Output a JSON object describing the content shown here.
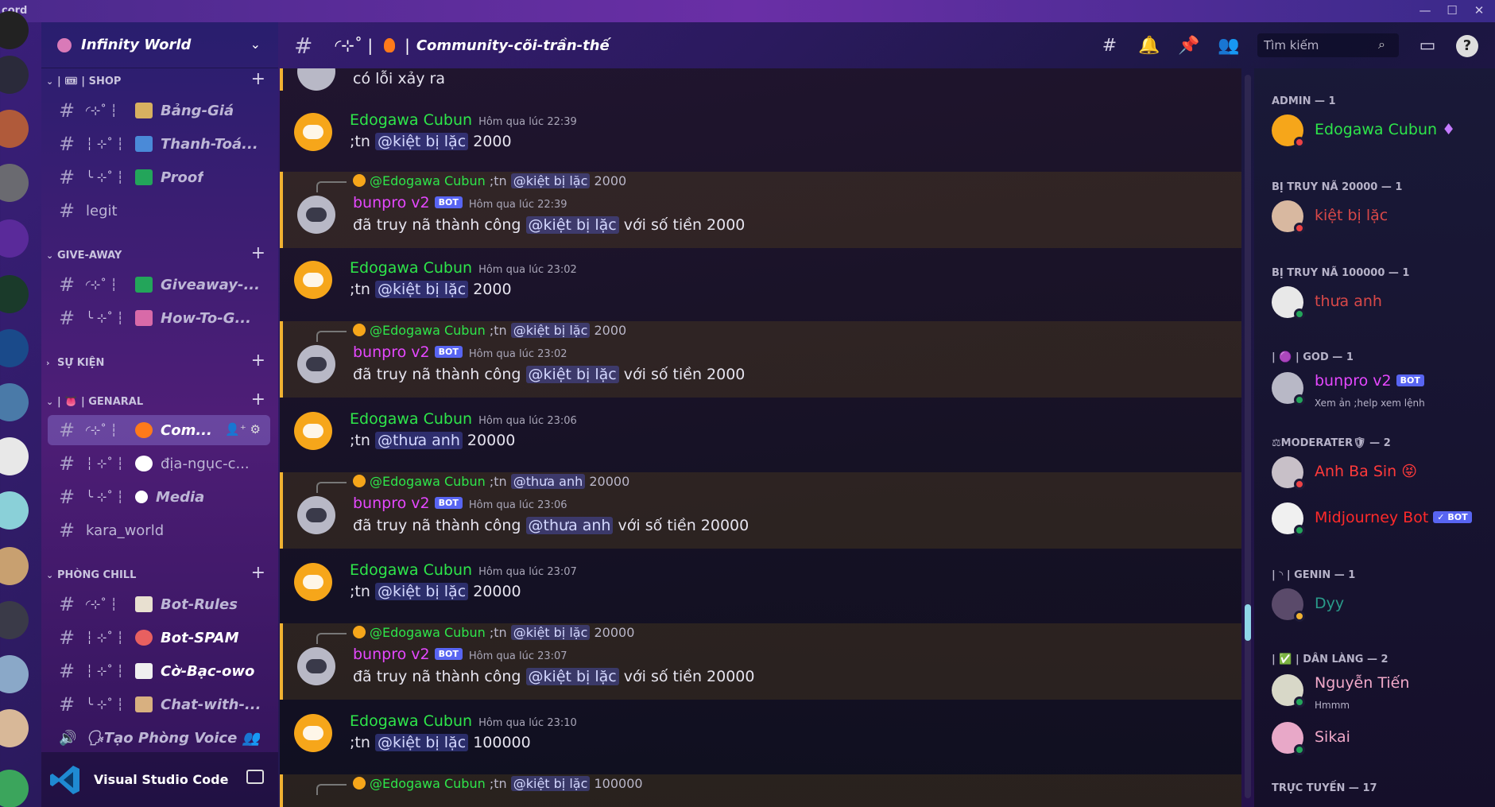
{
  "app": {
    "name": "cord",
    "window_controls": [
      "—",
      "☐",
      "✕"
    ]
  },
  "guild": {
    "name": "Infinity World"
  },
  "sidebar": {
    "categories": [
      {
        "label": "| 🎟 | SHOP"
      },
      {
        "label": "GIVE-AWAY"
      },
      {
        "label": "SỰ KIỆN"
      },
      {
        "label": "| 👅 | GENARAL"
      },
      {
        "label": "PHÒNG CHILL"
      }
    ],
    "channels": [
      {
        "deco": "◜⊹˚ ┆",
        "name": "Bảng-Giá",
        "emoji_color": "#d8b060"
      },
      {
        "deco": "┆ ⊹˚ ┆",
        "name": "Thanh-Toá...",
        "emoji_color": "#4a8ad8"
      },
      {
        "deco": "╰ ⊹˚ ┆",
        "name": "Proof",
        "emoji_color": "#23a55a"
      },
      {
        "deco": "",
        "name": "legit"
      },
      {
        "deco": "◜⊹˚ ┆",
        "name": "Giveaway-...",
        "emoji_color": "#23a55a"
      },
      {
        "deco": "╰ ⊹˚ ┆",
        "name": "How-To-G...",
        "emoji_color": "#d86aa8"
      },
      {
        "deco": "◜⊹˚ ┆",
        "name": "Com...",
        "emoji_color": "#ff7a1a"
      },
      {
        "deco": "┆ ⊹˚ ┆",
        "name": "địa-ngục-c...",
        "emoji_color": "#ffffff"
      },
      {
        "deco": "╰ ⊹˚ ┆",
        "name": "Media",
        "emoji_color": "#ffffff"
      },
      {
        "deco": "",
        "name": "kara_world"
      },
      {
        "deco": "◜⊹˚ ┆",
        "name": "Bot-Rules",
        "emoji_color": "#e8e0d0"
      },
      {
        "deco": "┆ ⊹˚ ┆",
        "name": "Bot-SPAM",
        "emoji_color": "#e86060"
      },
      {
        "deco": "┆ ⊹˚ ┆",
        "name": "Cờ-Bạc-owo",
        "emoji_color": "#f0f0f0"
      },
      {
        "deco": "╰ ⊹˚ ┆",
        "name": "Chat-with-...",
        "emoji_color": "#d8b080"
      }
    ],
    "voice_create": "🗣Tạo Phòng Voice 👥",
    "activity": "Visual Studio Code"
  },
  "header": {
    "deco": "◜⊹˚ |",
    "sep": "|",
    "title": "Community-cõi-trần-thế",
    "search_placeholder": "Tìm kiếm"
  },
  "messages": {
    "top_fragment": "có lỗi xảy ra",
    "items": [
      {
        "author": "Edogawa Cubun",
        "time": "Hôm qua lúc 22:39",
        "pre": ";tn ",
        "mention": "@kiệt bị lặc",
        "post": " 2000"
      },
      {
        "reply_author": "@Edogawa Cubun",
        "reply_pre": " ;tn ",
        "reply_mention": "@kiệt bị lặc",
        "reply_post": " 2000",
        "author": "bunpro v2",
        "bot": "BOT",
        "time": "Hôm qua lúc 22:39",
        "pre": "đã truy nã thành công ",
        "mention": "@kiệt bị lặc",
        "post": " với số tiền 2000"
      },
      {
        "author": "Edogawa Cubun",
        "time": "Hôm qua lúc 23:02",
        "pre": ";tn ",
        "mention": "@kiệt bị lặc",
        "post": " 2000"
      },
      {
        "reply_author": "@Edogawa Cubun",
        "reply_pre": " ;tn ",
        "reply_mention": "@kiệt bị lặc",
        "reply_post": " 2000",
        "author": "bunpro v2",
        "bot": "BOT",
        "time": "Hôm qua lúc 23:02",
        "pre": "đã truy nã thành công ",
        "mention": "@kiệt bị lặc",
        "post": " với số tiền 2000"
      },
      {
        "author": "Edogawa Cubun",
        "time": "Hôm qua lúc 23:06",
        "pre": ";tn ",
        "mention": "@thưa anh",
        "post": " 20000"
      },
      {
        "reply_author": "@Edogawa Cubun",
        "reply_pre": " ;tn ",
        "reply_mention": "@thưa anh",
        "reply_post": " 20000",
        "author": "bunpro v2",
        "bot": "BOT",
        "time": "Hôm qua lúc 23:06",
        "pre": "đã truy nã thành công ",
        "mention": "@thưa anh",
        "post": " với số tiền 20000"
      },
      {
        "author": "Edogawa Cubun",
        "time": "Hôm qua lúc 23:07",
        "pre": ";tn ",
        "mention": "@kiệt bị lặc",
        "post": " 20000"
      },
      {
        "reply_author": "@Edogawa Cubun",
        "reply_pre": " ;tn ",
        "reply_mention": "@kiệt bị lặc",
        "reply_post": " 20000",
        "author": "bunpro v2",
        "bot": "BOT",
        "time": "Hôm qua lúc 23:07",
        "pre": "đã truy nã thành công ",
        "mention": "@kiệt bị lặc",
        "post": " với số tiền 20000"
      },
      {
        "author": "Edogawa Cubun",
        "time": "Hôm qua lúc 23:10",
        "pre": ";tn ",
        "mention": "@kiệt bị lặc",
        "post": " 100000"
      }
    ],
    "bottom_reply": {
      "author": "@Edogawa Cubun",
      "pre": " ;tn ",
      "mention": "@kiệt bị lặc",
      "post": " 100000"
    }
  },
  "members": {
    "roles": [
      {
        "label": "ADMIN — 1"
      },
      {
        "label": "BỊ TRUY NÃ 20000 — 1"
      },
      {
        "label": "BỊ TRUY NÃ 100000 — 1"
      },
      {
        "label": "| 🟣 | GOD — 1"
      },
      {
        "label": "⚖MODERATER🛡 — 2"
      },
      {
        "label": "| ◝ | GENIN — 1"
      },
      {
        "label": "| ✅ | DÂN LÀNG — 2"
      },
      {
        "label": "TRỰC TUYẾN — 17"
      }
    ],
    "list": [
      {
        "name": "Edogawa Cubun",
        "suffix": "♦",
        "color": "#2ee54a",
        "sub": ""
      },
      {
        "name": "kiệt bị lặc",
        "color": "#d84848",
        "sub": ""
      },
      {
        "name": "thưa anh",
        "color": "#d84848",
        "sub": ""
      },
      {
        "name": "bunpro v2",
        "color": "#e548ff",
        "bot": "BOT",
        "sub": "Xem ản ;help xem lệnh"
      },
      {
        "name": "Anh Ba Sin",
        "suffix": "😝",
        "color": "#ff3a3a",
        "sub": ""
      },
      {
        "name": "Midjourney Bot",
        "color": "#ff2a2a",
        "bot": "✓ BOT",
        "sub": ""
      },
      {
        "name": "Dyy",
        "color": "#2a9a8a",
        "sub": ""
      },
      {
        "name": "Nguyễn Tiến",
        "color": "#f0a8c8",
        "sub": "Hmmm"
      },
      {
        "name": "Sikai",
        "color": "#f0a8c8",
        "sub": ""
      }
    ]
  },
  "colors": {
    "accent": "#5865f2",
    "mention_bg": "#3a3f8a",
    "highlight_border": "#f0b232"
  }
}
